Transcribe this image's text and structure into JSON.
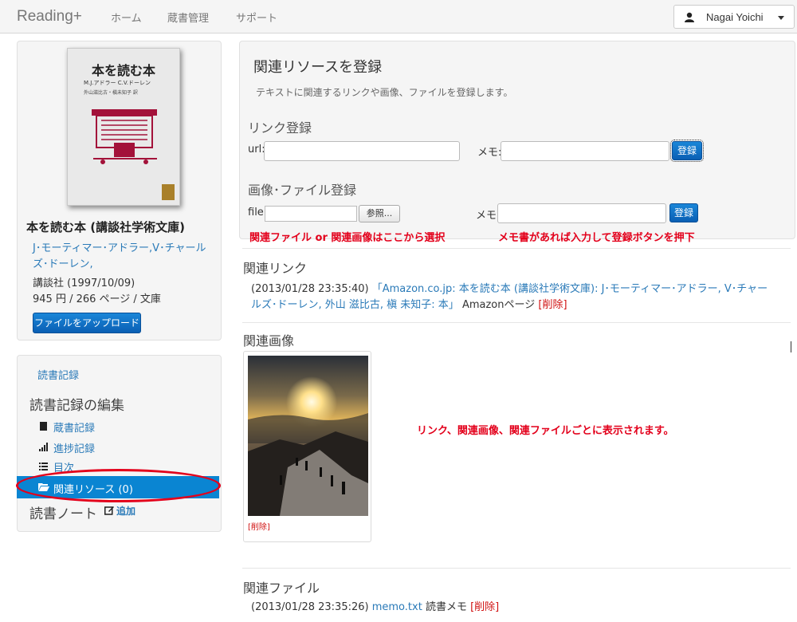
{
  "navbar": {
    "brand": "Reading+",
    "links": [
      "ホーム",
      "蔵書管理",
      "サポート"
    ],
    "user": "Nagai Yoichi"
  },
  "book": {
    "cover_title": "本を読む本",
    "cover_author": "M.J.アドラー  C.V.ドーレン",
    "cover_translator": "外山滋比古・槇未知子 訳",
    "title": "本を読む本 (講談社学術文庫)",
    "authors": "J･モーティマー･アドラー,V･チャールズ･ドーレン,",
    "publisher": "講談社 (1997/10/09)",
    "price_pages": "945 円 / 266 ページ / 文庫",
    "upload_button": "ファイルをアップロード"
  },
  "sidebar": {
    "top_link": "読書記録",
    "edit_heading": "読書記録の編集",
    "items": [
      {
        "label": "蔵書記録",
        "icon": "book-icon"
      },
      {
        "label": "進捗記録",
        "icon": "signal-icon"
      },
      {
        "label": "目次",
        "icon": "list-icon"
      },
      {
        "label": "関連リソース (0)",
        "icon": "folder-open-icon",
        "active": true
      }
    ],
    "notes_heading": "読書ノート",
    "add_label": "追加"
  },
  "register": {
    "title": "関連リソースを登録",
    "description": "テキストに関連するリンクや画像、ファイルを登録します。",
    "link_heading": "リンク登録",
    "url_label": "url:",
    "memo_label": "メモ:",
    "register_button": "登録",
    "file_heading": "画像･ファイル登録",
    "file_label": "file:",
    "browse_button": "参照...",
    "annotation_left": "関連ファイル or 関連画像はここから選択",
    "annotation_right": "メモ書があれば入力して登録ボタンを押下"
  },
  "related_links": {
    "heading": "関連リンク",
    "timestamp": "(2013/01/28 23:35:40)",
    "link_text": "「Amazon.co.jp: 本を読む本 (講談社学術文庫): J･モーティマー･アドラー, V･チャールズ･ドーレン, 外山 滋比古, 槇 未知子: 本」",
    "memo": "Amazonページ",
    "delete": "[削除]"
  },
  "related_images": {
    "heading": "関連画像",
    "delete": "[削除]",
    "annotation": "リンク、関連画像、関連ファイルごとに表示されます。"
  },
  "related_files": {
    "heading": "関連ファイル",
    "timestamp": "(2013/01/28 23:35:26)",
    "filename": "memo.txt",
    "memo": "読書メモ",
    "delete": "[削除]"
  },
  "colors": {
    "accent": "#0a85d2",
    "link": "#2a7ab8",
    "annotation": "#e3001b",
    "delete": "#d01010"
  }
}
